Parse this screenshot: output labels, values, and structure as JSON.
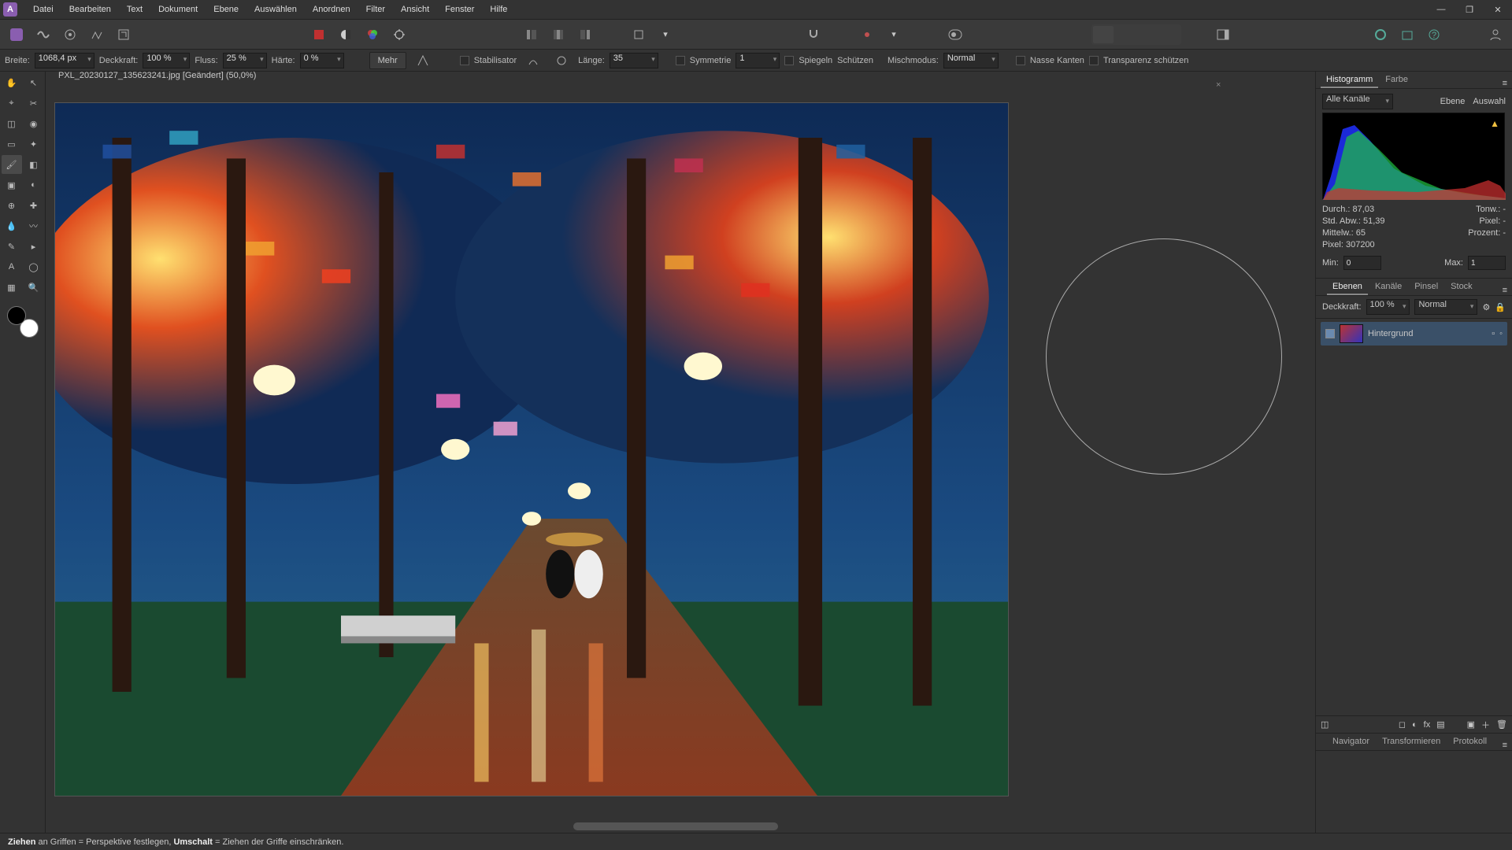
{
  "menubar": {
    "items": [
      "Datei",
      "Bearbeiten",
      "Text",
      "Dokument",
      "Ebene",
      "Auswählen",
      "Anordnen",
      "Filter",
      "Ansicht",
      "Fenster",
      "Hilfe"
    ]
  },
  "context": {
    "width_label": "Breite:",
    "width_value": "1068,4 px",
    "opacity_label": "Deckkraft:",
    "opacity_value": "100 %",
    "flow_label": "Fluss:",
    "flow_value": "25 %",
    "hardness_label": "Härte:",
    "hardness_value": "0 %",
    "more_label": "Mehr",
    "stabilizer_label": "Stabilisator",
    "length_label": "Länge:",
    "length_value": "35",
    "symmetry_label": "Symmetrie",
    "symmetry_value": "1",
    "mirror_label": "Spiegeln",
    "protect_label": "Schützen",
    "blendmode_label": "Mischmodus:",
    "blendmode_value": "Normal",
    "wetedges_label": "Nasse Kanten",
    "protectalpha_label": "Transparenz schützen"
  },
  "document": {
    "tab_label": "PXL_20230127_135623241.jpg [Geändert] (50,0%)"
  },
  "histogram": {
    "tab1": "Histogramm",
    "tab2": "Farbe",
    "channel_label": "Alle Kanäle",
    "scope1": "Ebene",
    "scope2": "Auswahl",
    "mean_label": "Durch.:",
    "mean_value": "87,03",
    "stddev_label": "Std. Abw.:",
    "stddev_value": "51,39",
    "median_label": "Mittelw.:",
    "median_value": "65",
    "pixel_label": "Pixel:",
    "pixel_value": "307200",
    "tone_label": "Tonw.:",
    "tone_value": "-",
    "pixel2_label": "Pixel:",
    "pixel2_value": "-",
    "percent_label": "Prozent:",
    "percent_value": "-",
    "min_label": "Min:",
    "min_value": "0",
    "max_label": "Max:",
    "max_value": "1"
  },
  "layers_panel": {
    "tabs": [
      "Ebenen",
      "Kanäle",
      "Pinsel",
      "Stock"
    ],
    "opacity_label": "Deckkraft:",
    "opacity_value": "100 %",
    "blend_value": "Normal",
    "layer0_name": "Hintergrund"
  },
  "nav_panel": {
    "tabs": [
      "Navigator",
      "Transformieren",
      "Protokoll"
    ]
  },
  "hint": {
    "t1": "Ziehen",
    "t2": " an Griffen = Perspektive festlegen, ",
    "t3": "Umschalt",
    "t4": " = Ziehen der Griffe einschränken."
  }
}
